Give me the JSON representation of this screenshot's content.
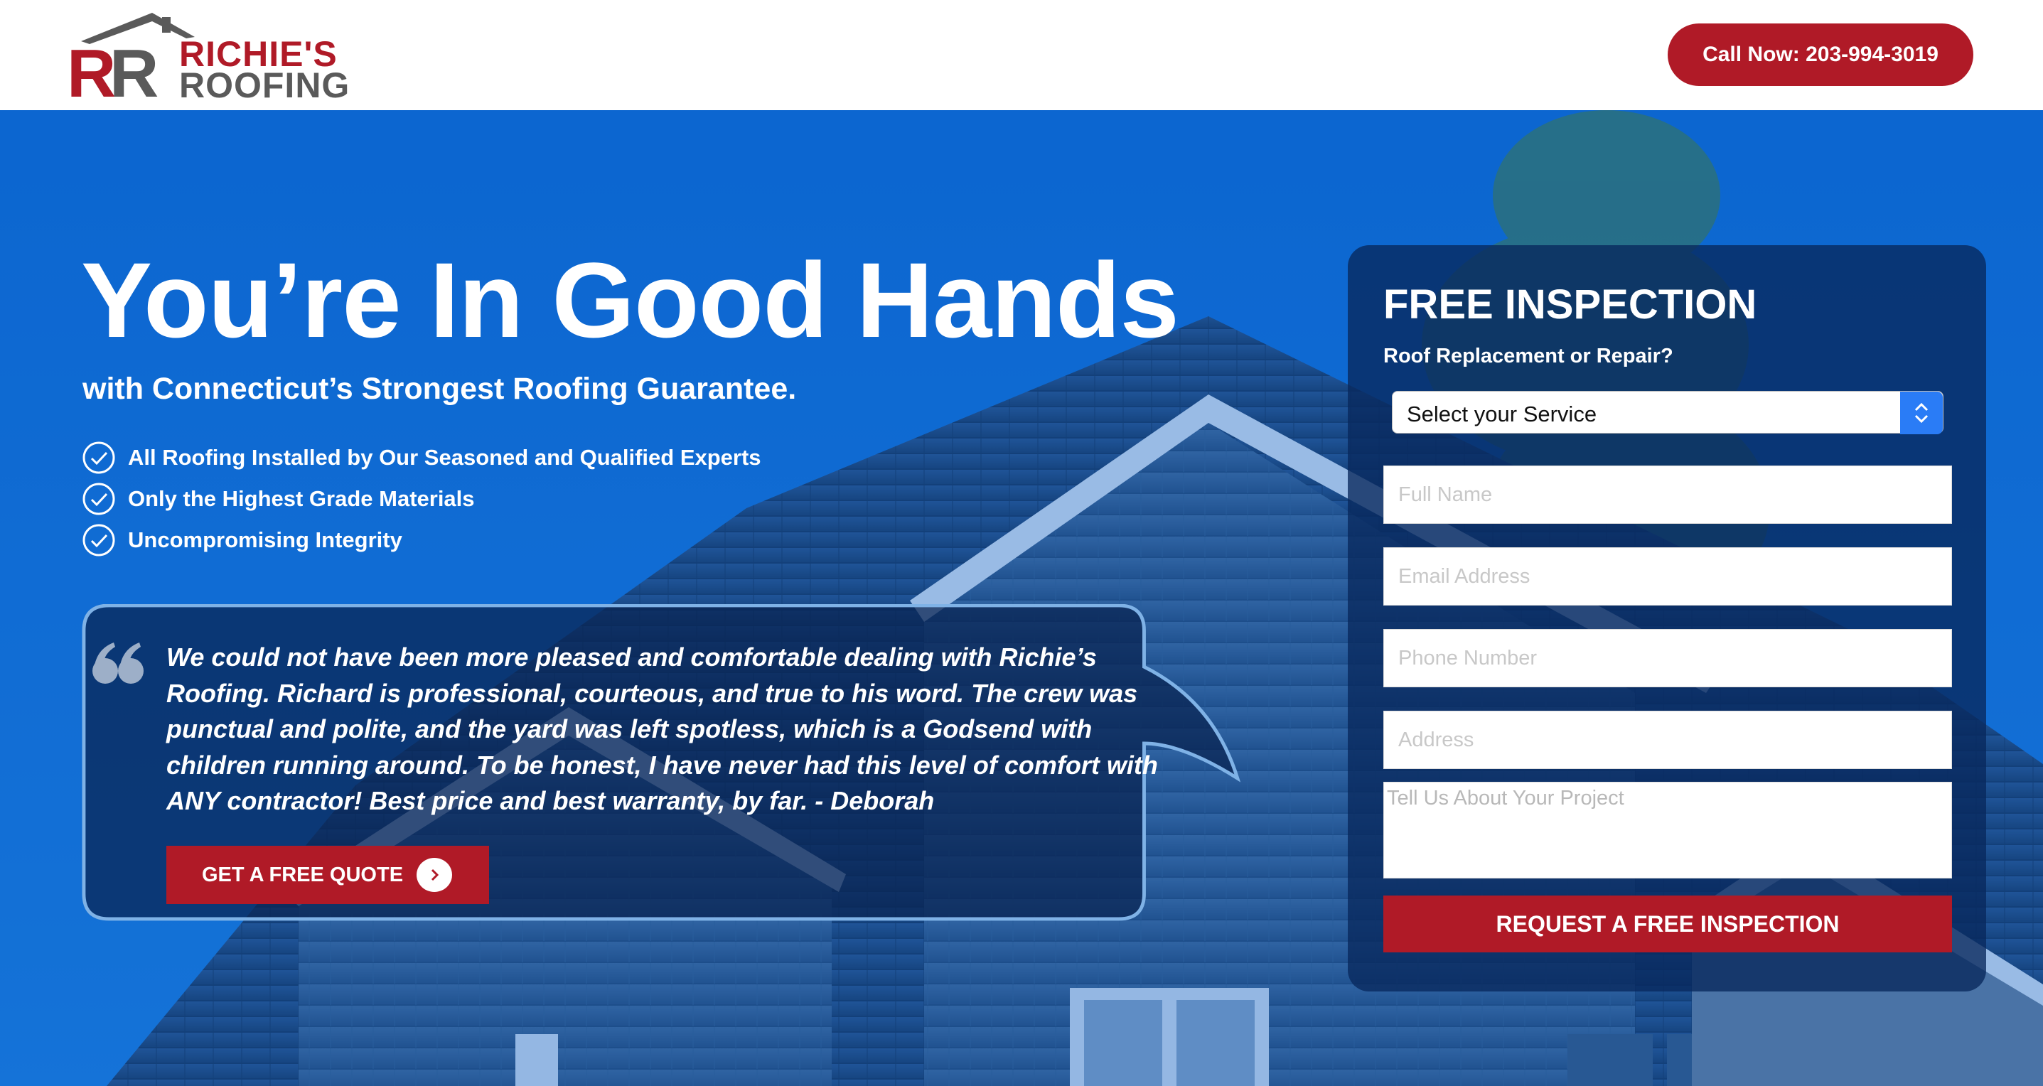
{
  "brand": {
    "logo_monogram": "RR",
    "logo_line1": "RICHIE'S",
    "logo_line2": "ROOFING",
    "primary_color": "#b01a27",
    "hero_blue": "#1570d6"
  },
  "header": {
    "call_button_label": "Call Now: 203-994-3019"
  },
  "hero": {
    "headline": "You’re In Good Hands",
    "subheadline": "with Connecticut’s Strongest Roofing Guarantee.",
    "features": [
      {
        "label": "All Roofing Installed by Our Seasoned and Qualified Experts",
        "icon": "check-circle-icon"
      },
      {
        "label": "Only the Highest Grade Materials",
        "icon": "check-circle-icon"
      },
      {
        "label": "Uncompromising Integrity",
        "icon": "check-circle-icon"
      }
    ],
    "testimonial": {
      "icon": "quote-icon",
      "lines": [
        "We could not have been more pleased and comfortable dealing with Richie’s",
        "Roofing. Richard is professional, courteous, and true to his word. The crew was",
        "punctual and polite, and the yard was left spotless, which is a Godsend with",
        "children running around. To be honest, I have never had this level of comfort with",
        "ANY contractor! Best price and best warranty, by far. - Deborah"
      ],
      "button_label": "GET A FREE QUOTE",
      "button_icon": "chevron-right-icon"
    }
  },
  "form": {
    "title": "FREE INSPECTION",
    "question": "Roof Replacement or Repair?",
    "select_value": "Select your Service",
    "fields": {
      "full_name": {
        "placeholder": "Full Name"
      },
      "email": {
        "placeholder": "Email Address"
      },
      "phone": {
        "placeholder": "Phone Number"
      },
      "address": {
        "placeholder": "Address"
      },
      "project": {
        "placeholder": "Tell Us About Your Project"
      }
    },
    "submit_label": "REQUEST A FREE INSPECTION"
  }
}
